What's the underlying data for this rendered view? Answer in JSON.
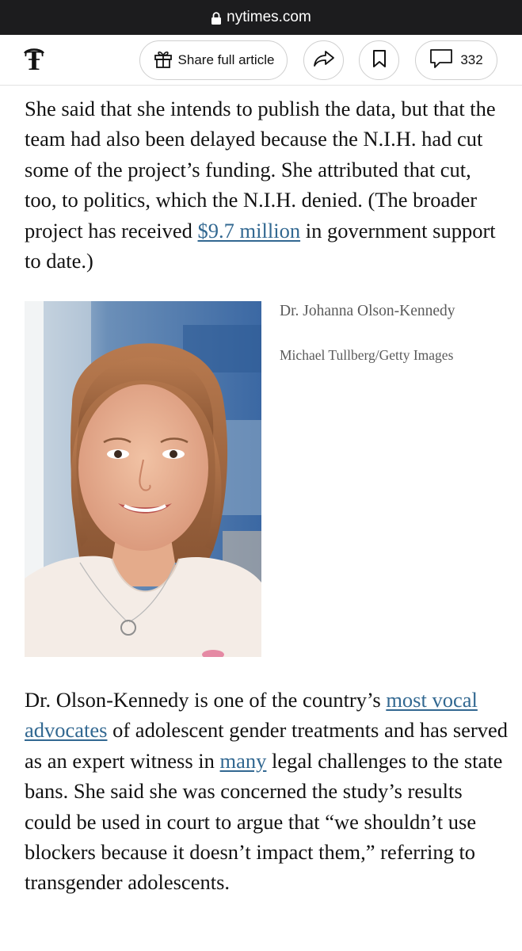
{
  "browser": {
    "url": "nytimes.com"
  },
  "toolbar": {
    "logo_icon": "nyt-t-logo-icon",
    "share_label": "Share full article",
    "comment_count": "332"
  },
  "article": {
    "para1": {
      "text_before_link": "She said that she intends to publish the data, but that the team had also been delayed because the N.I.H. had cut some of the project’s funding. She attributed that cut, too, to politics, which the N.I.H. denied. (The broader project has received ",
      "link": "$9.7 million",
      "text_after_link": " in government support to date.)"
    },
    "photo": {
      "caption": "Dr. Johanna Olson-Kennedy",
      "credit": "Michael Tullberg/Getty Images"
    },
    "para2": {
      "t1": "Dr. Olson-Kennedy is one of the country’s ",
      "link1": "most vocal",
      "t2": " ",
      "link2": "advocates",
      "t3": " of adolescent gender treatments and has served as an expert witness in ",
      "link3": "many",
      "t4": " legal challenges to the state bans. She said she was concerned the study’s results could be used in court to argue that “we shouldn’t use blockers because it doesn’t impact them,” referring to transgender adolescents."
    }
  },
  "colors": {
    "link": "#326891",
    "text": "#121212",
    "caption": "#5a5a5a",
    "url_bar": "#1c1c1e"
  }
}
